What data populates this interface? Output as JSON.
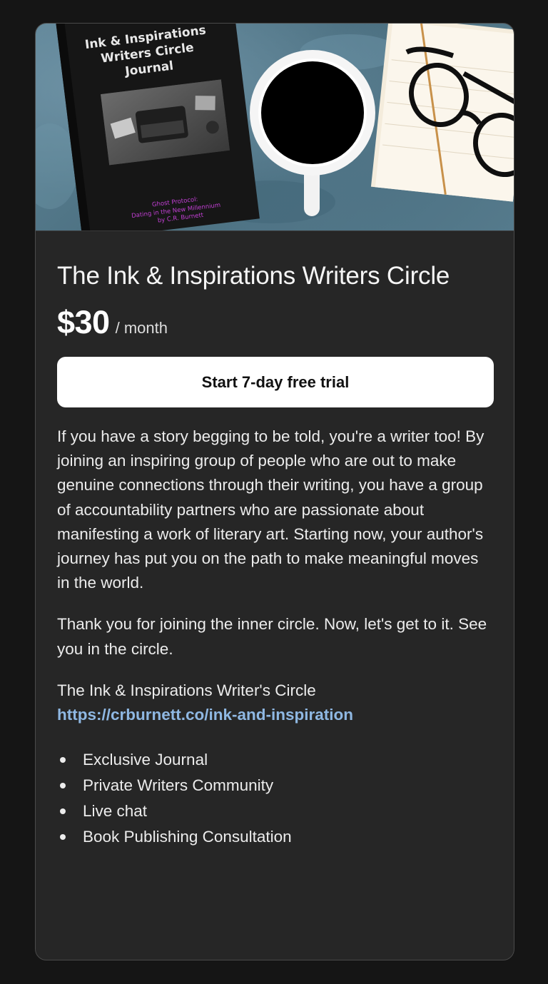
{
  "hero": {
    "journal_title_lines": [
      "Ink & Inspirations",
      "Writers Circle",
      "Journal"
    ],
    "journal_subtitle_lines": [
      "Ghost Protocol:",
      "Dating in the New Millennium",
      "by C.R. Burnett"
    ]
  },
  "tier": {
    "title": "The Ink & Inspirations Writers Circle",
    "price": "$30",
    "period": "/ month",
    "cta_label": "Start 7-day free trial"
  },
  "description": {
    "paragraph_1": "If you have a story begging to be told, you're a writer too! By joining an inspiring group of people who are out to make genuine connections through their writing, you have a group of accountability partners who are passionate about manifesting a work of literary art. Starting now, your author's journey has put you on the path to make meaningful moves in the world.",
    "paragraph_2": "Thank you for joining the inner circle. Now, let's get to it. See you in the circle.",
    "signature": "The Ink & Inspirations Writer's Circle",
    "link": "https://crburnett.co/ink-and-inspiration"
  },
  "benefits": [
    "Exclusive Journal",
    "Private Writers Community",
    "Live chat",
    "Book Publishing Consultation"
  ],
  "colors": {
    "page_bg": "#151515",
    "card_bg": "#262626",
    "link": "#8fb8e3",
    "button_bg": "#ffffff"
  }
}
